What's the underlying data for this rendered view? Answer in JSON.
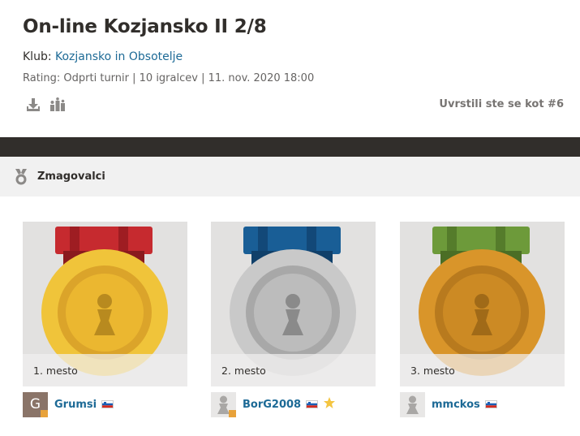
{
  "header": {
    "title": "On-line Kozjansko II 2/8",
    "club_prefix": "Klub: ",
    "club_name": "Kozjansko in Obsotelje",
    "meta": "Rating: Odprti turnir | 10 igralcev | 11. nov. 2020 18:00",
    "rank_note": "Uvrstili ste se kot #6",
    "tools": [
      {
        "icon": "download-icon"
      },
      {
        "icon": "leaderboard-icon"
      }
    ]
  },
  "section": {
    "icon": "medal-icon",
    "title": "Zmagovalci"
  },
  "winners": [
    {
      "place": "1. mesto",
      "medal": "gold",
      "ribbon_color": "#c62a2f",
      "username": "Grumsi",
      "avatar_letter": "G",
      "avatar_type": "letter",
      "flag": "slovenia-flag-icon",
      "star": false
    },
    {
      "place": "2. mesto",
      "medal": "silver",
      "ribbon_color": "#195e96",
      "username": "BorG2008",
      "avatar_letter": "",
      "avatar_type": "pawn",
      "flag": "slovenia-flag-icon",
      "star": true
    },
    {
      "place": "3. mesto",
      "medal": "bronze",
      "ribbon_color": "#6d9a3a",
      "username": "mmckos",
      "avatar_letter": "",
      "avatar_type": "pawn",
      "flag": "slovenia-flag-icon",
      "star": false
    }
  ],
  "colors": {
    "link": "#1d6a96",
    "dark_bar": "#312e2b",
    "gold": "#f0c43a",
    "silver": "#c9c9c9",
    "bronze": "#d9952a"
  }
}
